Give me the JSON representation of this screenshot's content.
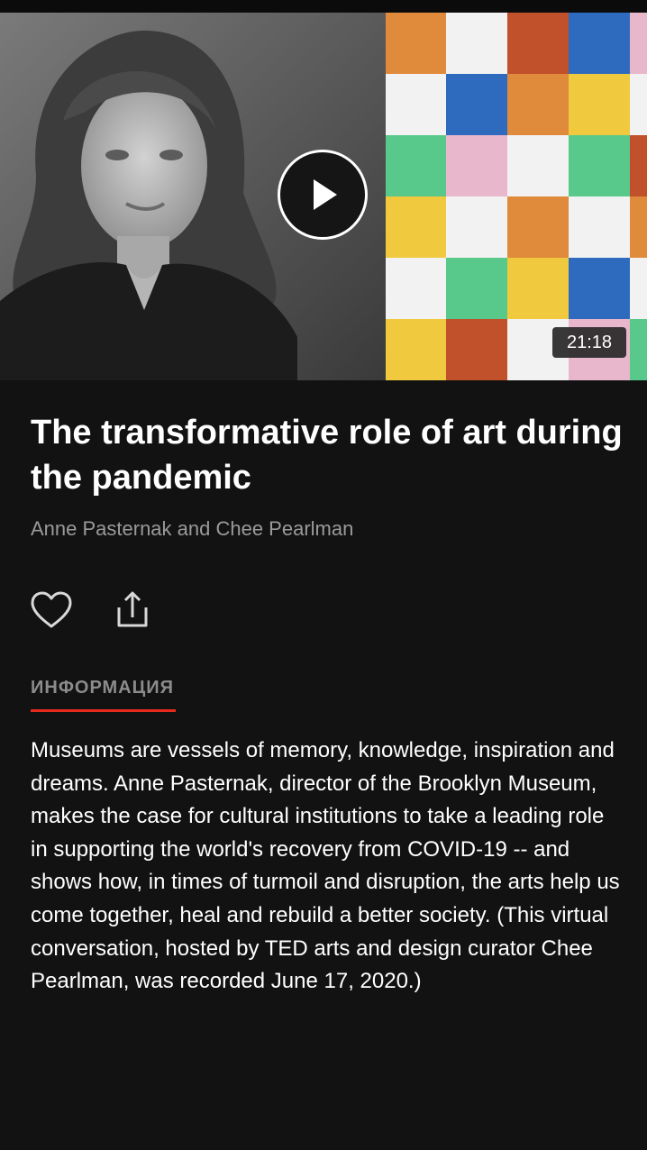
{
  "video": {
    "duration": "21:18",
    "play_icon": "play-icon"
  },
  "talk": {
    "title": "The transformative role of art during the pandemic",
    "speakers": "Anne Pasternak and Chee Pearlman"
  },
  "actions": {
    "like_icon": "heart-icon",
    "share_icon": "share-icon"
  },
  "tabs": {
    "info_label": "ИНФОРМАЦИЯ"
  },
  "description": "Museums are vessels of memory, knowledge, inspiration and dreams. Anne Pasternak, director of the Brooklyn Museum, makes the case for cultural institutions to take a leading role in supporting the world's recovery from COVID-19 -- and shows how, in times of turmoil and disruption, the arts help us come together, heal and rebuild a better society. (This virtual conversation, hosted by TED arts and design curator Chee Pearlman, was recorded June 17, 2020.)",
  "colors": {
    "background": "#121212",
    "accent": "#e62b1e",
    "muted_text": "#9a9a9a",
    "mosaic": [
      "#e08a3c",
      "#f2f2f2",
      "#c0512a",
      "#2e6bbf",
      "#e8b7cc",
      "#58c98a",
      "#f0c93e"
    ]
  }
}
